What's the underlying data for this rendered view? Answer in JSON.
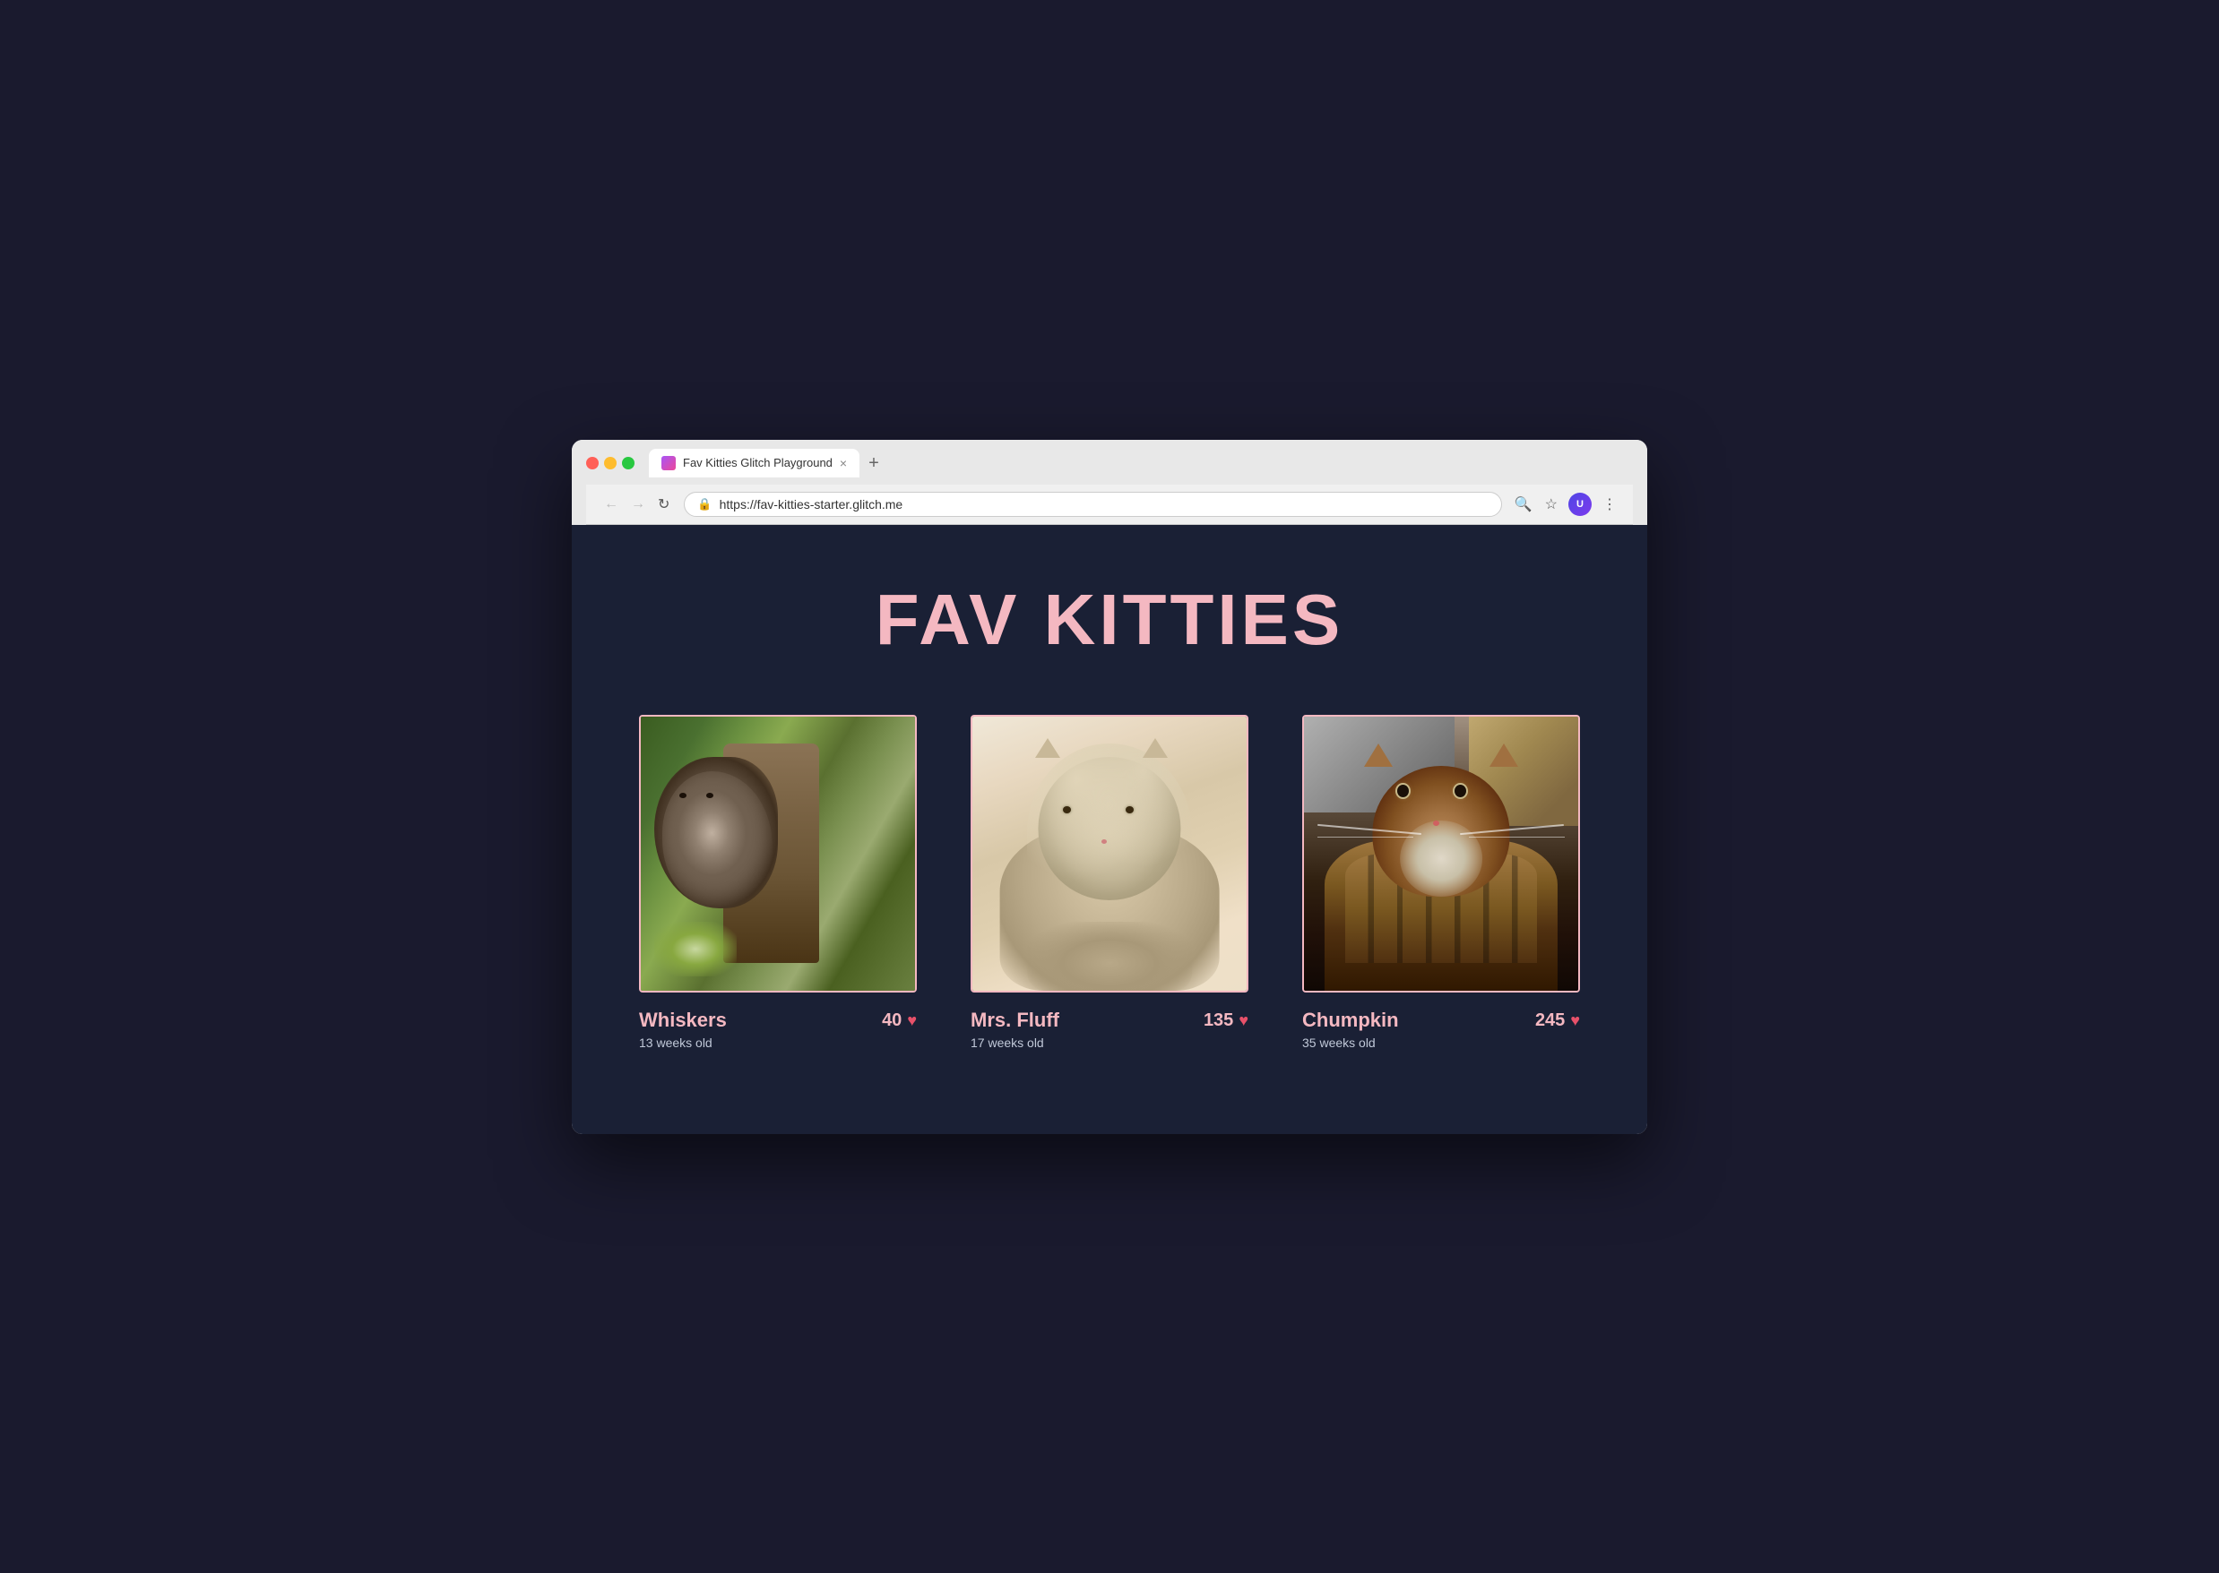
{
  "browser": {
    "tab_title": "Fav Kitties Glitch Playground",
    "tab_close": "×",
    "tab_new": "+",
    "back_btn": "←",
    "forward_btn": "→",
    "reload_btn": "↻",
    "url": "https://fav-kitties-starter.glitch.me",
    "search_icon": "🔍",
    "bookmark_icon": "☆",
    "more_icon": "⋮"
  },
  "page": {
    "title": "FAV KITTIES"
  },
  "kitties": [
    {
      "id": "whiskers",
      "name": "Whiskers",
      "age": "13 weeks old",
      "votes": "40",
      "style": "whiskers"
    },
    {
      "id": "mrs-fluff",
      "name": "Mrs. Fluff",
      "age": "17 weeks old",
      "votes": "135",
      "style": "mrs-fluff"
    },
    {
      "id": "chumpkin",
      "name": "Chumpkin",
      "age": "35 weeks old",
      "votes": "245",
      "style": "chumpkin"
    }
  ],
  "colors": {
    "background": "#1a2035",
    "title_color": "#f4b8c1",
    "name_color": "#f4b8c1",
    "age_color": "#c0c8d8",
    "votes_color": "#f4b8c1",
    "heart_color": "#e8516a",
    "card_border": "#f4b8c1"
  }
}
